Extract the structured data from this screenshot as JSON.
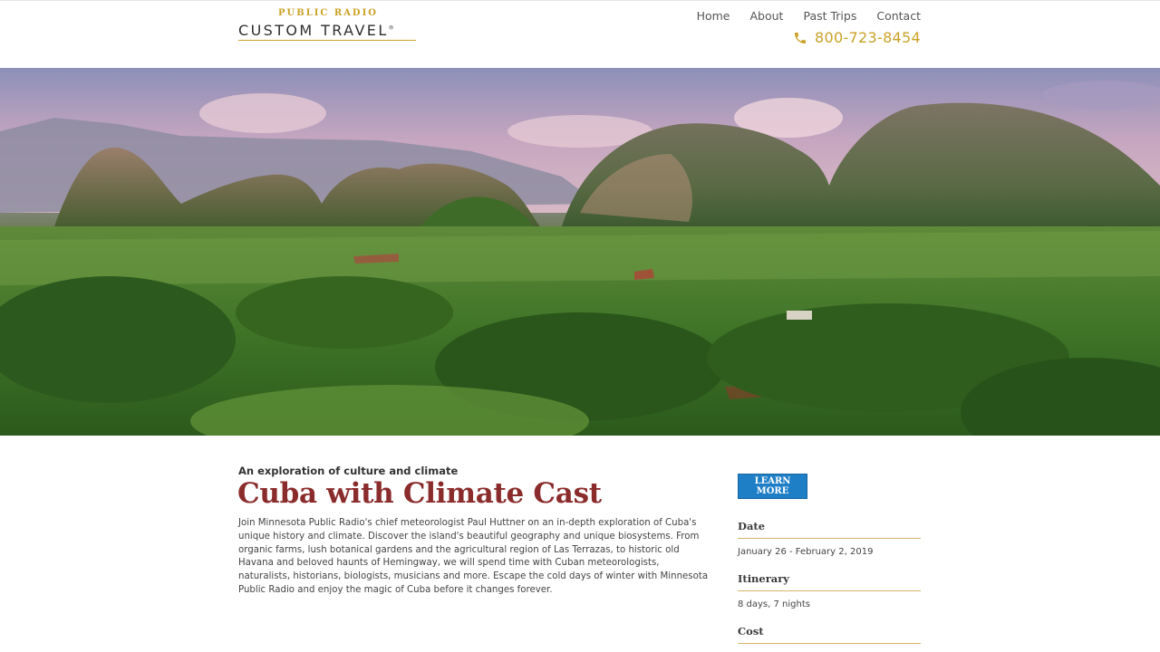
{
  "header": {
    "logo_top": "PUBLIC RADIO",
    "logo_main": "CUSTOM TRAVEL",
    "logo_mark": "®",
    "nav": [
      "Home",
      "About",
      "Past Trips",
      "Contact"
    ],
    "phone": "800-723-8454"
  },
  "main": {
    "subtitle": "An exploration of culture and climate",
    "title": "Cuba with Climate Cast",
    "description": "Join Minnesota Public Radio's chief meteorologist Paul Huttner on an in-depth exploration of Cuba's unique history and climate. Discover the island's beautiful geography and unique biosystems. From organic farms, lush botanical gardens and the agricultural region of Las Terrazas, to historic old Havana and beloved haunts of Hemingway, we will spend time with Cuban meteorologists, naturalists, historians, biologists, musicians and more. Escape the cold days of winter with Minnesota Public Radio and enjoy the magic of Cuba before it changes forever."
  },
  "sidebar": {
    "learn_more": "LEARN MORE",
    "date_label": "Date",
    "date_value": "January 26 - February 2, 2019",
    "itinerary_label": "Itinerary",
    "itinerary_value": "8 days, 7 nights",
    "cost_label": "Cost"
  },
  "colors": {
    "accent_gold": "#c9a227",
    "title_red": "#8b2c2c",
    "button_blue": "#1e7fc6"
  },
  "icons": {
    "phone": "phone-icon"
  }
}
